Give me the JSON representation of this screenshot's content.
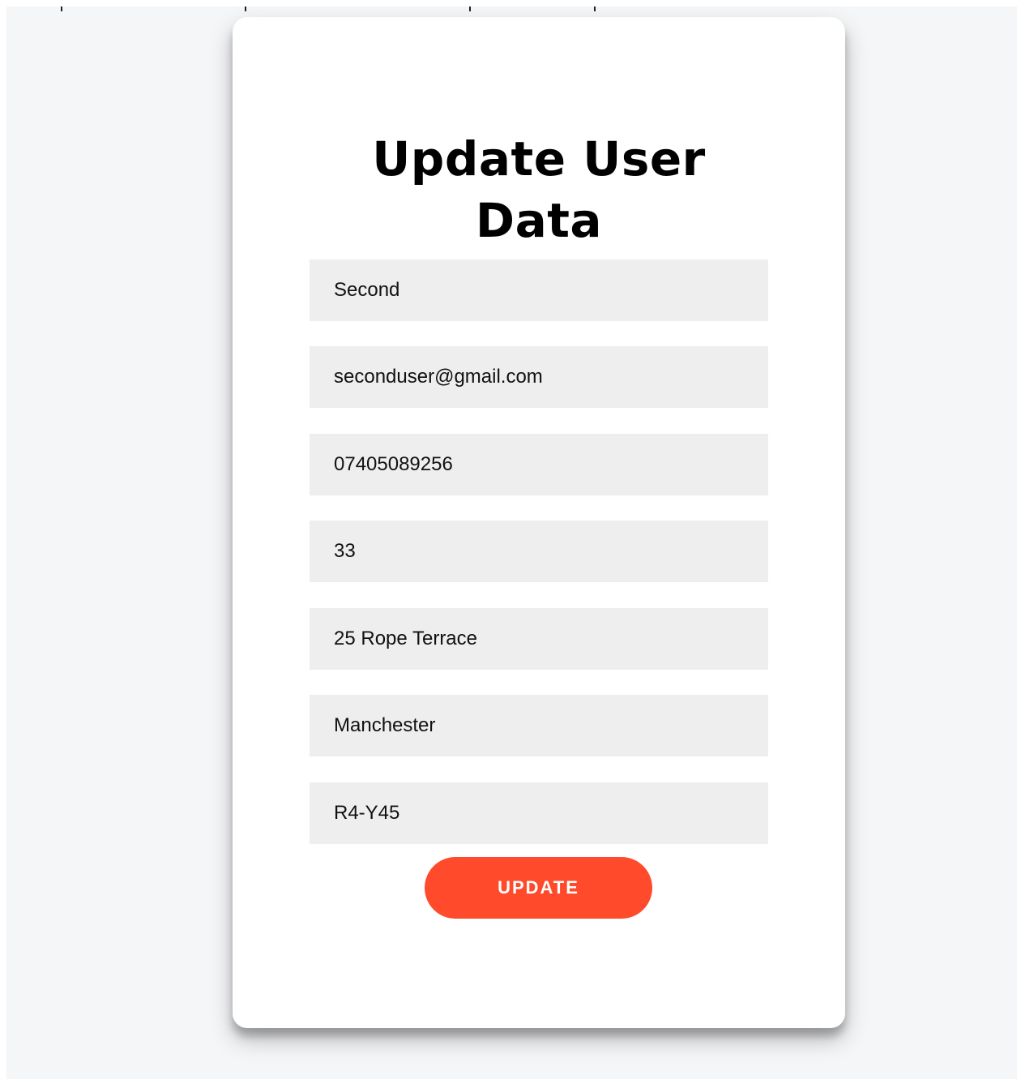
{
  "form": {
    "title_line1": "Update User",
    "title_line2": "Data",
    "fields": [
      {
        "value": "Second"
      },
      {
        "value": "seconduser@gmail.com"
      },
      {
        "value": "07405089256"
      },
      {
        "value": "33"
      },
      {
        "value": "25 Rope Terrace"
      },
      {
        "value": "Manchester"
      },
      {
        "value": "R4-Y45"
      }
    ],
    "submit_label": "UPDATE"
  },
  "colors": {
    "page_background": "#f5f6f8",
    "card_background": "#ffffff",
    "field_background": "#eeeeee",
    "button_background": "#ff4b2b",
    "button_text": "#ffffff"
  }
}
